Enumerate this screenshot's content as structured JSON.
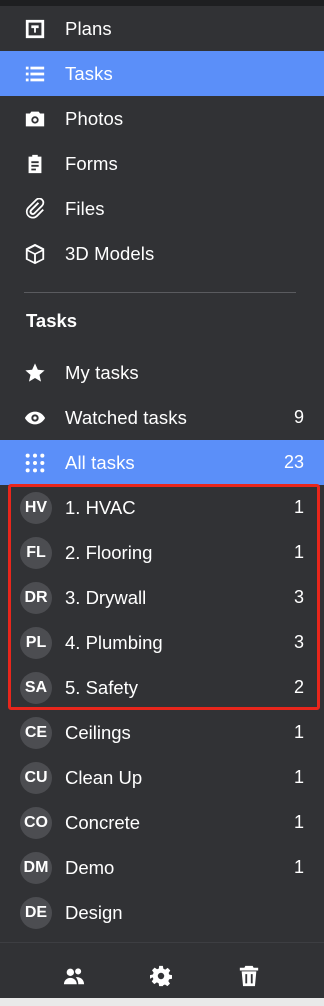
{
  "nav": {
    "plans": "Plans",
    "tasks": "Tasks",
    "photos": "Photos",
    "forms": "Forms",
    "files": "Files",
    "models": "3D Models"
  },
  "section_title": "Tasks",
  "task_filters": {
    "my_tasks": "My tasks",
    "watched_tasks": "Watched tasks",
    "watched_count": "9",
    "all_tasks": "All tasks",
    "all_count": "23"
  },
  "groups": [
    {
      "initials": "HV",
      "label": "1. HVAC",
      "count": "1"
    },
    {
      "initials": "FL",
      "label": "2. Flooring",
      "count": "1"
    },
    {
      "initials": "DR",
      "label": "3. Drywall",
      "count": "3"
    },
    {
      "initials": "PL",
      "label": "4. Plumbing",
      "count": "3"
    },
    {
      "initials": "SA",
      "label": "5. Safety",
      "count": "2"
    },
    {
      "initials": "CE",
      "label": "Ceilings",
      "count": "1"
    },
    {
      "initials": "CU",
      "label": "Clean Up",
      "count": "1"
    },
    {
      "initials": "CO",
      "label": "Concrete",
      "count": "1"
    },
    {
      "initials": "DM",
      "label": "Demo",
      "count": "1"
    },
    {
      "initials": "DE",
      "label": "Design",
      "count": ""
    }
  ],
  "colors": {
    "background": "#313235",
    "active": "#5b8ff9",
    "highlight": "#e8261c",
    "avatar": "#4c4d51"
  },
  "icons": {
    "plans": "floor-plan-icon",
    "tasks": "list-icon",
    "photos": "camera-icon",
    "forms": "clipboard-icon",
    "files": "paperclip-icon",
    "models": "cube-icon",
    "my_tasks": "star-icon",
    "watched": "eye-icon",
    "all": "grid-dots-icon",
    "footer_people": "people-icon",
    "footer_settings": "gear-icon",
    "footer_trash": "trash-icon"
  }
}
